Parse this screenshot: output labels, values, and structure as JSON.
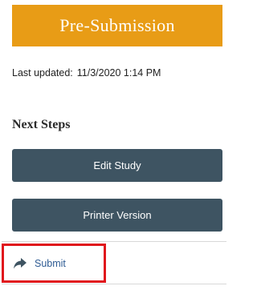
{
  "state_banner": {
    "label": "Pre-Submission"
  },
  "last_updated": {
    "label": "Last updated:",
    "value": "11/3/2020 1:14 PM"
  },
  "next_steps": {
    "heading": "Next Steps",
    "buttons": [
      {
        "label": "Edit Study"
      },
      {
        "label": "Printer Version"
      }
    ]
  },
  "activities": [
    {
      "label": "Submit",
      "icon": "share-arrow-icon"
    }
  ],
  "colors": {
    "banner": "#e89c16",
    "button": "#3e5462",
    "highlight_border": "#e0151c",
    "link": "#2e5b93"
  }
}
